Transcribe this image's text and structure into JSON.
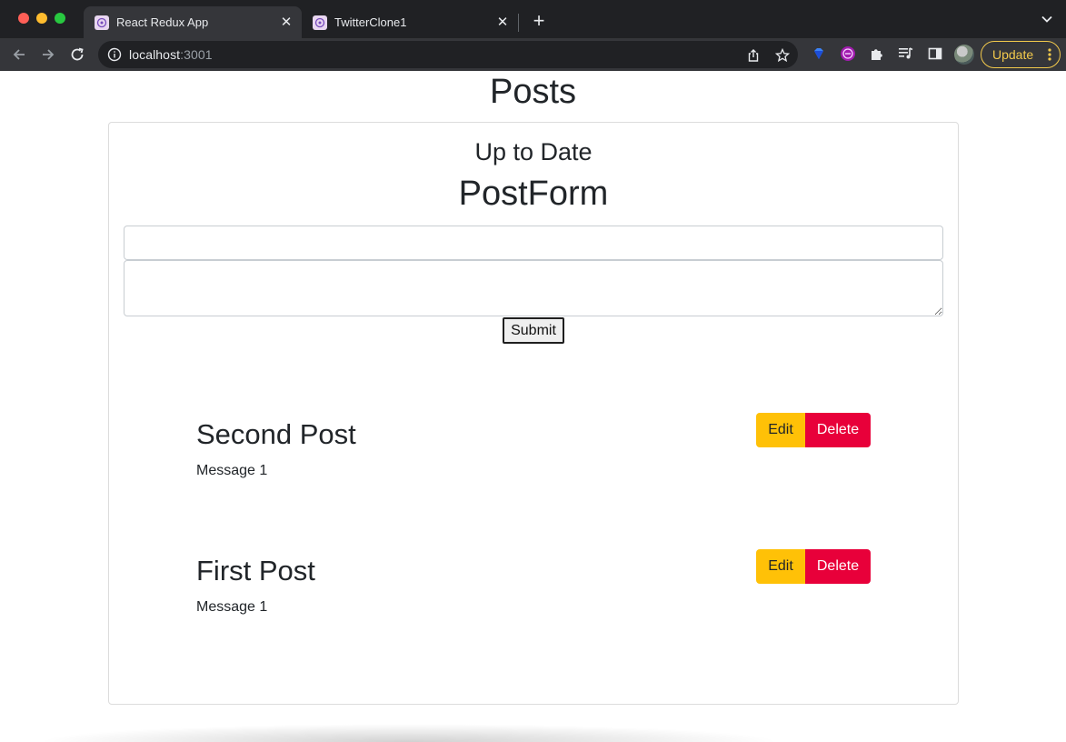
{
  "browser": {
    "tabs": [
      {
        "title": "React Redux App",
        "active": true
      },
      {
        "title": "TwitterClone1",
        "active": false
      }
    ],
    "url_host": "localhost",
    "url_port": ":3001",
    "update_label": "Update"
  },
  "page": {
    "title": "Posts",
    "subtitle": "Up to Date",
    "form_title": "PostForm",
    "title_input_value": "",
    "body_input_value": "",
    "submit_label": "Submit"
  },
  "posts": [
    {
      "title": "Second Post",
      "message": "Message 1",
      "edit_label": "Edit",
      "delete_label": "Delete"
    },
    {
      "title": "First Post",
      "message": "Message 1",
      "edit_label": "Edit",
      "delete_label": "Delete"
    }
  ],
  "colors": {
    "edit": "#ffc107",
    "delete": "#e8003a",
    "update_accent": "#f2c94c"
  }
}
